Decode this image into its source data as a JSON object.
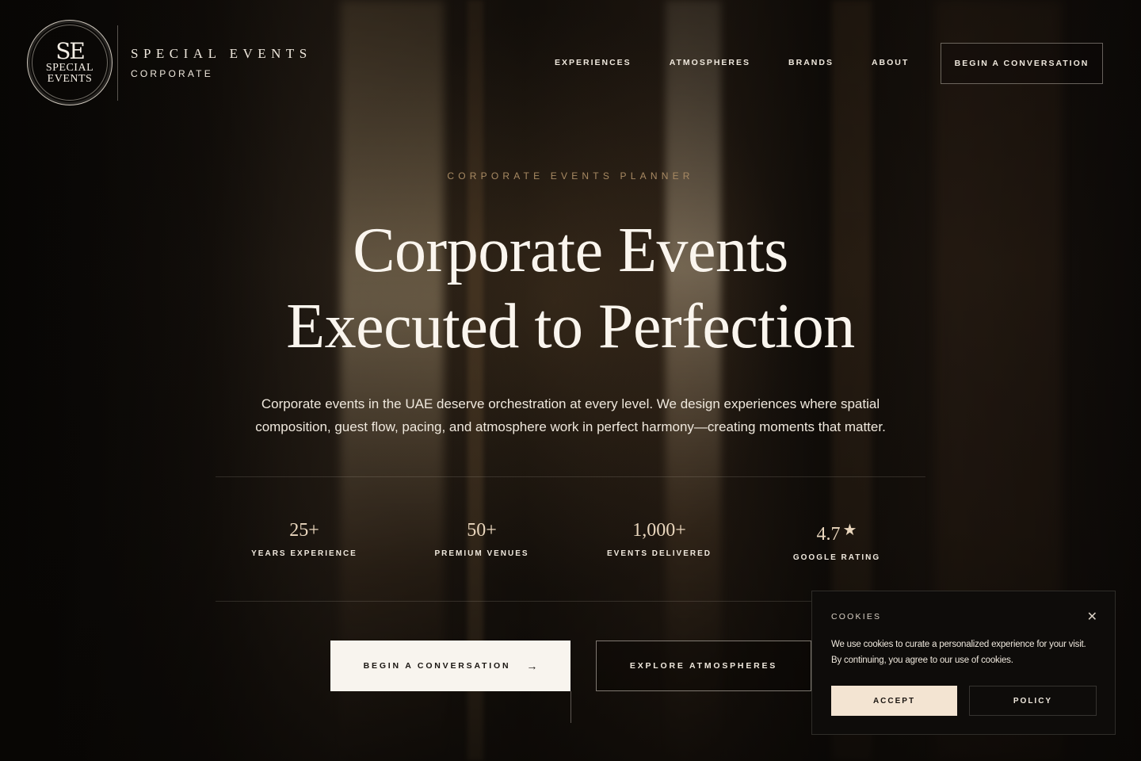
{
  "brand": {
    "logo_monogram": "SE",
    "logo_line1": "SPECIAL",
    "logo_line2": "EVENTS",
    "name": "SPECIAL EVENTS",
    "sub": "CORPORATE"
  },
  "nav": {
    "items": [
      {
        "label": "EXPERIENCES"
      },
      {
        "label": "ATMOSPHERES"
      },
      {
        "label": "BRANDS"
      },
      {
        "label": "ABOUT"
      }
    ],
    "cta_label": "BEGIN A CONVERSATION"
  },
  "hero": {
    "eyebrow": "CORPORATE EVENTS PLANNER",
    "title_line1": "Corporate Events",
    "title_line2": "Executed to Perfection",
    "description": "Corporate events in the UAE deserve orchestration at every level. We design experiences where spatial composition, guest flow, pacing, and atmosphere work in perfect harmony—creating moments that matter."
  },
  "stats": [
    {
      "value": "25+",
      "label": "YEARS EXPERIENCE"
    },
    {
      "value": "50+",
      "label": "PREMIUM VENUES"
    },
    {
      "value": "1,000+",
      "label": "EVENTS DELIVERED"
    },
    {
      "value": "4.7",
      "label": "GOOGLE RATING",
      "icon": "star-icon"
    }
  ],
  "actions": {
    "primary_label": "BEGIN A CONVERSATION",
    "primary_icon": "arrow-right-icon",
    "secondary_label": "EXPLORE ATMOSPHERES"
  },
  "cookie": {
    "title": "COOKIES",
    "close_icon": "close-icon",
    "text": "We use cookies to curate a personalized experience for your visit. By continuing, you agree to our use of cookies.",
    "accept_label": "ACCEPT",
    "policy_label": "POLICY"
  },
  "colors": {
    "accent_gold": "#a88a63",
    "accept_bg": "#f3e4d2",
    "primary_btn_bg": "#f8f4ee"
  }
}
